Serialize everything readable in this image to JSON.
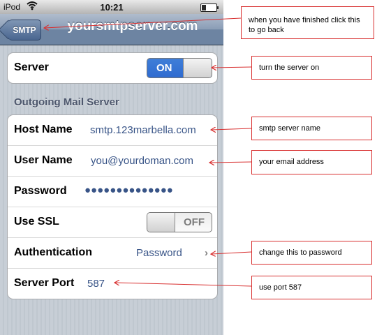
{
  "statusbar": {
    "carrier": "iPod",
    "time": "10:21"
  },
  "navbar": {
    "back_label": "SMTP",
    "title": "yoursmtpserver.com"
  },
  "server_group": {
    "server_label": "Server",
    "server_switch": "ON"
  },
  "outgoing": {
    "header": "Outgoing Mail Server",
    "host_label": "Host Name",
    "host_value": "smtp.123marbella.com",
    "user_label": "User Name",
    "user_value": "you@yourdoman.com",
    "password_label": "Password",
    "password_value": "●●●●●●●●●●●●●●",
    "ssl_label": "Use SSL",
    "ssl_switch": "OFF",
    "auth_label": "Authentication",
    "auth_value": "Password",
    "port_label": "Server Port",
    "port_value": "587"
  },
  "annotations": {
    "back_note": "when you have finished click this to go back",
    "server_note": "turn the server on",
    "host_note": "smtp server name",
    "user_note": "your email address",
    "auth_note": "change this to password",
    "port_note": "use port 587"
  },
  "colors": {
    "annotation_border": "#d83030",
    "arrow": "#d83030",
    "switch_on": "#2f6bd0",
    "value_text": "#385487"
  },
  "icons": {
    "wifi": "wifi-icon",
    "battery": "battery-icon",
    "chevron": "chevron-right-icon"
  }
}
